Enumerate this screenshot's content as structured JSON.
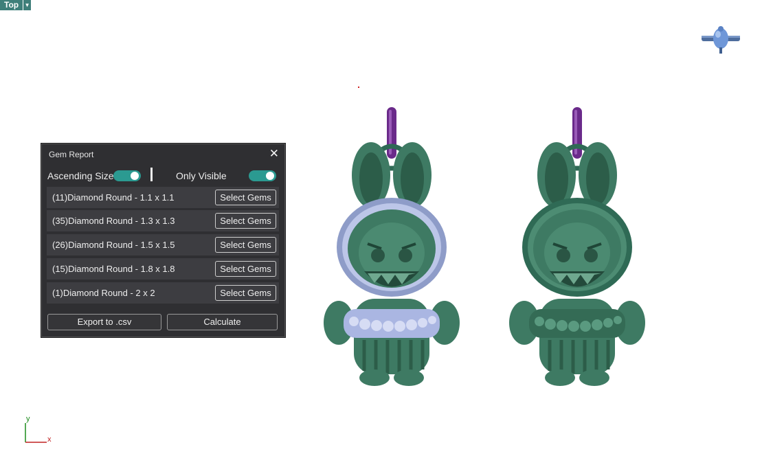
{
  "viewport": {
    "name": "Top",
    "dropdown_icon": "chevron-down-icon"
  },
  "axes": {
    "y_label": "y",
    "x_label": "x"
  },
  "gem_report": {
    "title": "Gem Report",
    "close_icon": "close-icon",
    "ascending_size_label": "Ascending Size",
    "ascending_size_on": true,
    "only_visible_label": "Only Visible",
    "only_visible_on": true,
    "rows": [
      {
        "label": "(11)Diamond Round - 1.1 x 1.1",
        "button": "Select Gems"
      },
      {
        "label": "(35)Diamond Round - 1.3 x 1.3",
        "button": "Select Gems"
      },
      {
        "label": "(26)Diamond Round - 1.5 x 1.5",
        "button": "Select Gems"
      },
      {
        "label": "(15)Diamond Round - 1.8 x 1.8",
        "button": "Select Gems"
      },
      {
        "label": "(1)Diamond Round - 2 x 2",
        "button": "Select Gems"
      }
    ],
    "export_label": "Export to .csv",
    "calculate_label": "Calculate"
  },
  "colors": {
    "accent": "#2b9a91",
    "panel_bg": "#2f2f32",
    "model_green": "#3e7a63",
    "ring_purple": "#6a2a8a",
    "gem_blue": "#a9b6e0"
  }
}
